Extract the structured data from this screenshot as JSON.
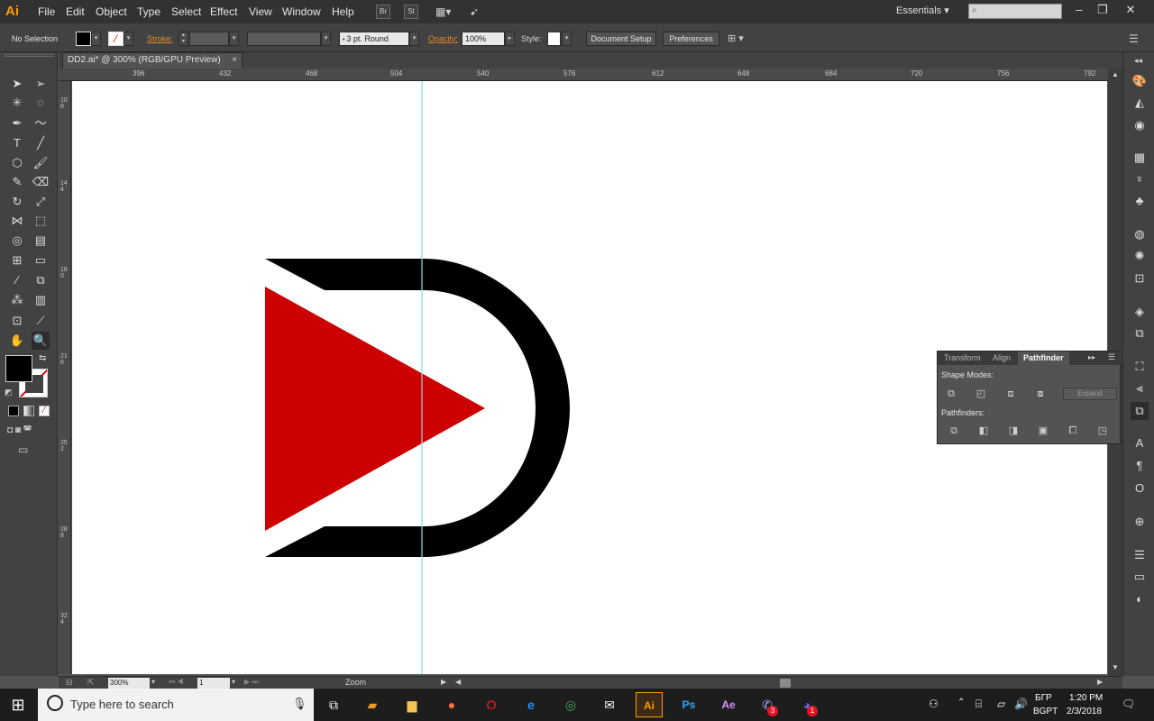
{
  "app": {
    "logo": "Ai",
    "menu": [
      "File",
      "Edit",
      "Object",
      "Type",
      "Select",
      "Effect",
      "View",
      "Window",
      "Help"
    ],
    "menubar_buttons": [
      "Br",
      "St"
    ],
    "workspace": "Essentials",
    "window_controls": [
      "minimize",
      "restore",
      "close"
    ]
  },
  "control_bar": {
    "selection": "No Selection",
    "stroke_label": "Stroke:",
    "brush": "3 pt. Round",
    "opacity_label": "Opacity:",
    "opacity_value": "100%",
    "style_label": "Style:",
    "doc_setup": "Document Setup",
    "preferences": "Preferences"
  },
  "document": {
    "tab_title": "DD2.ai* @ 300% (RGB/GPU Preview)",
    "close": "×",
    "ruler_top": [
      "396",
      "432",
      "468",
      "504",
      "540",
      "576",
      "612",
      "648",
      "684",
      "720",
      "756",
      "792"
    ],
    "ruler_left": [
      "108",
      "144",
      "180",
      "216",
      "252",
      "288",
      "324"
    ],
    "zoom": "300%",
    "artboard": "1",
    "status": "Zoom"
  },
  "pathfinder": {
    "tabs": [
      "Transform",
      "Align",
      "Pathfinder"
    ],
    "active_tab": "Pathfinder",
    "shape_modes_label": "Shape Modes:",
    "pathfinders_label": "Pathfinders:",
    "expand": "Expand"
  },
  "artwork": {
    "d_color": "#000000",
    "triangle_color": "#cc0000",
    "guide_color": "#7fe3e6"
  },
  "taskbar": {
    "search_placeholder": "Type here to search",
    "apps": [
      "task-view",
      "sublime",
      "file-explorer",
      "firefox",
      "opera",
      "edge",
      "chrome",
      "mail",
      "illustrator",
      "photoshop",
      "after-effects",
      "messenger",
      "viber"
    ],
    "app_labels": {
      "illustrator": "Ai",
      "photoshop": "Ps",
      "after_effects": "Ae"
    },
    "badges": {
      "messenger": "3",
      "viber": "1"
    },
    "lang_top": "БГР",
    "lang_bottom": "BGPT",
    "time": "1:20 PM",
    "date": "2/3/2018"
  }
}
